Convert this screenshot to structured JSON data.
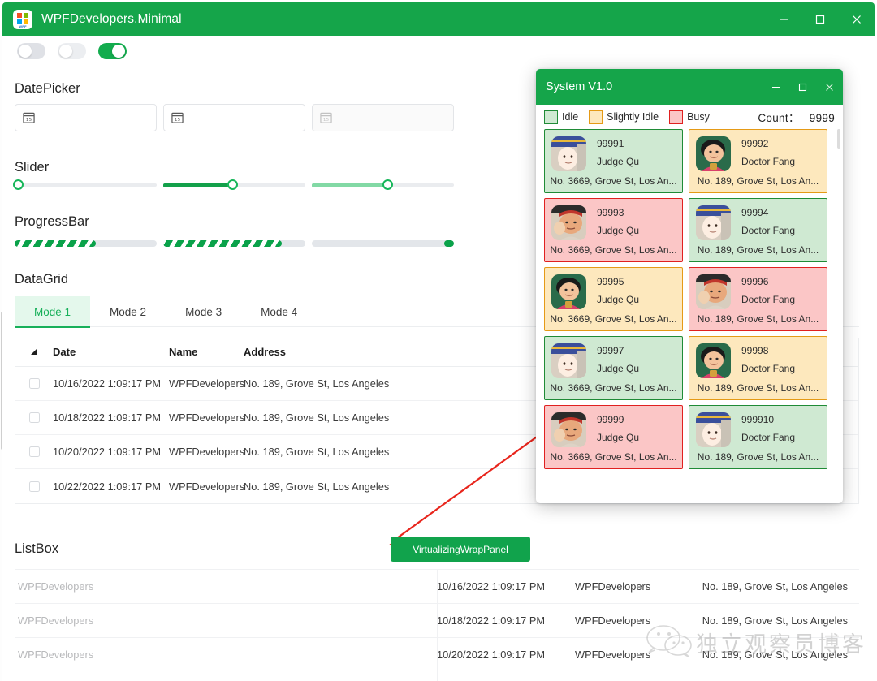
{
  "window": {
    "title": "WPFDevelopers.Minimal",
    "icon": "wpf-logo-icon",
    "minimize": "–",
    "maximize": "□",
    "close": "×"
  },
  "toggles": [
    {
      "name": "toggle-1",
      "state": "off"
    },
    {
      "name": "toggle-2",
      "state": "off"
    },
    {
      "name": "toggle-3",
      "state": "on"
    }
  ],
  "sections": {
    "datepicker": "DatePicker",
    "slider": "Slider",
    "progressbar": "ProgressBar",
    "datagrid": "DataGrid",
    "listbox": "ListBox"
  },
  "datepickers": [
    {
      "value": "",
      "placeholder": "",
      "icon": "calendar-icon",
      "enabled": true
    },
    {
      "value": "",
      "placeholder": "",
      "icon": "calendar-icon",
      "enabled": true
    },
    {
      "value": "",
      "placeholder": "",
      "icon": "calendar-icon",
      "enabled": false
    }
  ],
  "sliders": [
    {
      "value": 0,
      "fill_color": "#17b65a",
      "track_color": "#eaecef"
    },
    {
      "value": 47,
      "fill_color": "#13a04a",
      "track_color": "#eaecef"
    },
    {
      "value": 53,
      "fill_color": "#82d9a5",
      "track_color": "#eaecef"
    }
  ],
  "progressbars": [
    {
      "value": 57,
      "style": "striped"
    },
    {
      "value": 83,
      "style": "striped"
    },
    {
      "value": 97,
      "style": "solid"
    }
  ],
  "tabs": [
    {
      "label": "Mode 1",
      "active": true
    },
    {
      "label": "Mode 2",
      "active": false
    },
    {
      "label": "Mode 3",
      "active": false
    },
    {
      "label": "Mode 4",
      "active": false
    }
  ],
  "datagrid": {
    "columns": [
      "",
      "Date",
      "Name",
      "Address"
    ],
    "rows": [
      {
        "date": "10/16/2022 1:09:17 PM",
        "name": "WPFDevelopers",
        "address": "No. 189, Grove St, Los Angeles",
        "checked": false
      },
      {
        "date": "10/18/2022 1:09:17 PM",
        "name": "WPFDevelopers",
        "address": "No. 189, Grove St, Los Angeles",
        "checked": false
      },
      {
        "date": "10/20/2022 1:09:17 PM",
        "name": "WPFDevelopers",
        "address": "No. 189, Grove St, Los Angeles",
        "checked": false
      },
      {
        "date": "10/22/2022 1:09:17 PM",
        "name": "WPFDevelopers",
        "address": "No. 189, Grove St, Los Angeles",
        "checked": false
      }
    ]
  },
  "vw_button": {
    "label": "VirtualizingWrapPanel",
    "color": "#11a34c"
  },
  "listbox": {
    "left_items": [
      "WPFDevelopers",
      "WPFDevelopers",
      "WPFDevelopers"
    ],
    "right_rows": [
      {
        "date": "10/16/2022 1:09:17 PM",
        "name": "WPFDevelopers",
        "address": "No. 189, Grove St, Los Angeles"
      },
      {
        "date": "10/18/2022 1:09:17 PM",
        "name": "WPFDevelopers",
        "address": "No. 189, Grove St, Los Angeles"
      },
      {
        "date": "10/20/2022 1:09:17 PM",
        "name": "WPFDevelopers",
        "address": "No. 189, Grove St, Los Angeles"
      }
    ]
  },
  "system_window": {
    "title": "System V1.0",
    "minimize": "–",
    "maximize": "□",
    "close": "×",
    "legend": [
      {
        "label": "Idle",
        "fill": "#cfe9d2",
        "border": "#1f8b36"
      },
      {
        "label": "Slightly Idle",
        "fill": "#fde8bd",
        "border": "#e59a16"
      },
      {
        "label": "Busy",
        "fill": "#fbc6c6",
        "border": "#e02020"
      }
    ],
    "count_label": "Count：",
    "count_value": "9999",
    "cards": [
      {
        "id": "99991",
        "name": "Judge Qu",
        "address": "No. 3669, Grove St, Los An...",
        "status": "Idle",
        "avatar": "samurai-avatar"
      },
      {
        "id": "99992",
        "name": "Doctor Fang",
        "address": "No. 189, Grove St, Los An...",
        "status": "Slightly Idle",
        "avatar": "boy-avatar"
      },
      {
        "id": "99993",
        "name": "Judge Qu",
        "address": "No. 3669, Grove St, Los An...",
        "status": "Busy",
        "avatar": "wrestler-avatar"
      },
      {
        "id": "99994",
        "name": "Doctor Fang",
        "address": "No. 189, Grove St, Los An...",
        "status": "Idle",
        "avatar": "samurai-avatar"
      },
      {
        "id": "99995",
        "name": "Judge Qu",
        "address": "No. 3669, Grove St, Los An...",
        "status": "Slightly Idle",
        "avatar": "boy-avatar"
      },
      {
        "id": "99996",
        "name": "Doctor Fang",
        "address": "No. 189, Grove St, Los An...",
        "status": "Busy",
        "avatar": "wrestler-avatar"
      },
      {
        "id": "99997",
        "name": "Judge Qu",
        "address": "No. 3669, Grove St, Los An...",
        "status": "Idle",
        "avatar": "samurai-avatar"
      },
      {
        "id": "99998",
        "name": "Doctor Fang",
        "address": "No. 189, Grove St, Los An...",
        "status": "Slightly Idle",
        "avatar": "boy-avatar"
      },
      {
        "id": "99999",
        "name": "Judge Qu",
        "address": "No. 3669, Grove St, Los An...",
        "status": "Busy",
        "avatar": "wrestler-avatar"
      },
      {
        "id": "999910",
        "name": "Doctor Fang",
        "address": "No. 189, Grove St, Los An...",
        "status": "Idle",
        "avatar": "samurai-avatar"
      }
    ]
  },
  "watermark": {
    "text": "独立观察员博客",
    "icon": "wechat-icon"
  },
  "colors": {
    "accent": "#15a54a",
    "accent_light": "#e4f8ec",
    "idle_fill": "#cfe9d2",
    "idle_border": "#1f8b36",
    "slight_fill": "#fde8bd",
    "slight_border": "#e59a16",
    "busy_fill": "#fbc6c6",
    "busy_border": "#e02020",
    "arrow": "#e8251c"
  }
}
